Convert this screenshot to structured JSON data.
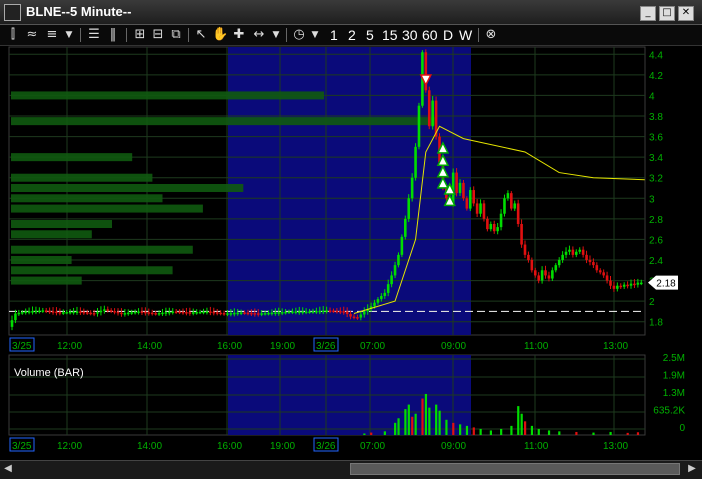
{
  "window": {
    "title": "BLNE--5 Minute--"
  },
  "window_buttons": {
    "minimize": "_",
    "restore": "□",
    "close": "✕"
  },
  "toolbar": {
    "intervals": [
      "1",
      "2",
      "5",
      "15",
      "30",
      "60",
      "D",
      "W"
    ]
  },
  "chart": {
    "price_axis_labels": [
      "4.4",
      "4.2",
      "4",
      "3.8",
      "3.6",
      "3.4",
      "3.2",
      "3",
      "2.8",
      "2.6",
      "2.4",
      "2.2",
      "2",
      "1.8"
    ],
    "current_price": "2.18",
    "time_labels": [
      "3/25",
      "12:00",
      "14:00",
      "16:00",
      "19:00",
      "3/26",
      "07:00",
      "09:00",
      "11:00",
      "13:00"
    ],
    "volume_label": "Volume (BAR)",
    "volume_axis_labels": [
      "2.5M",
      "1.9M",
      "1.3M",
      "635.2K",
      "0"
    ],
    "colors": {
      "up": "#00dd00",
      "down": "#e01010",
      "vwap": "#e6e600",
      "session": "#0a0a7a",
      "grid": "#1e3a1e",
      "axis_text": "#00b000"
    }
  },
  "chart_data": {
    "type": "candlestick",
    "title": "BLNE--5 Minute--",
    "ylim": [
      1.7,
      4.5
    ],
    "price_path": [
      [
        0,
        1.75
      ],
      [
        2,
        1.88
      ],
      [
        5,
        1.9
      ],
      [
        10,
        1.91
      ],
      [
        15,
        1.89
      ],
      [
        20,
        1.9
      ],
      [
        25,
        1.88
      ],
      [
        28,
        1.92
      ],
      [
        33,
        1.88
      ],
      [
        38,
        1.9
      ],
      [
        43,
        1.88
      ],
      [
        48,
        1.9
      ],
      [
        53,
        1.89
      ],
      [
        58,
        1.9
      ],
      [
        63,
        1.88
      ],
      [
        68,
        1.89
      ],
      [
        73,
        1.88
      ],
      [
        78,
        1.89
      ],
      [
        83,
        1.9
      ],
      [
        88,
        1.9
      ],
      [
        93,
        1.91
      ],
      [
        98,
        1.9
      ],
      [
        100,
        1.85
      ],
      [
        102,
        1.84
      ],
      [
        104,
        1.9
      ],
      [
        106,
        1.95
      ],
      [
        108,
        2.02
      ],
      [
        110,
        2.08
      ],
      [
        112,
        2.25
      ],
      [
        114,
        2.45
      ],
      [
        116,
        2.8
      ],
      [
        118,
        3.2
      ],
      [
        119,
        3.5
      ],
      [
        120,
        3.9
      ],
      [
        121,
        4.42
      ],
      [
        122,
        4.05
      ],
      [
        123,
        3.7
      ],
      [
        124,
        3.95
      ],
      [
        125,
        3.6
      ],
      [
        126,
        3.35
      ],
      [
        127,
        3.1
      ],
      [
        128,
        3.0
      ],
      [
        129,
        2.95
      ],
      [
        130,
        3.25
      ],
      [
        131,
        3.05
      ],
      [
        132,
        3.15
      ],
      [
        133,
        3.0
      ],
      [
        134,
        2.9
      ],
      [
        135,
        3.08
      ],
      [
        136,
        2.95
      ],
      [
        137,
        2.85
      ],
      [
        138,
        2.95
      ],
      [
        139,
        2.8
      ],
      [
        140,
        2.7
      ],
      [
        141,
        2.75
      ],
      [
        142,
        2.68
      ],
      [
        143,
        2.72
      ],
      [
        144,
        2.85
      ],
      [
        145,
        3.0
      ],
      [
        146,
        3.05
      ],
      [
        147,
        2.9
      ],
      [
        148,
        2.95
      ],
      [
        149,
        2.75
      ],
      [
        150,
        2.55
      ],
      [
        151,
        2.45
      ],
      [
        152,
        2.4
      ],
      [
        153,
        2.3
      ],
      [
        154,
        2.25
      ],
      [
        155,
        2.2
      ],
      [
        156,
        2.3
      ],
      [
        157,
        2.25
      ],
      [
        158,
        2.22
      ],
      [
        159,
        2.3
      ],
      [
        160,
        2.35
      ],
      [
        161,
        2.4
      ],
      [
        162,
        2.45
      ],
      [
        163,
        2.48
      ],
      [
        164,
        2.5
      ],
      [
        165,
        2.45
      ],
      [
        166,
        2.48
      ],
      [
        167,
        2.5
      ],
      [
        168,
        2.45
      ],
      [
        169,
        2.4
      ],
      [
        170,
        2.38
      ],
      [
        171,
        2.35
      ],
      [
        172,
        2.3
      ],
      [
        173,
        2.28
      ],
      [
        174,
        2.25
      ],
      [
        175,
        2.2
      ],
      [
        176,
        2.15
      ],
      [
        177,
        2.12
      ],
      [
        178,
        2.15
      ],
      [
        179,
        2.14
      ],
      [
        180,
        2.16
      ],
      [
        181,
        2.15
      ],
      [
        182,
        2.17
      ],
      [
        183,
        2.16
      ],
      [
        184,
        2.18
      ],
      [
        185,
        2.18
      ]
    ],
    "vwap": [
      [
        100,
        1.88
      ],
      [
        112,
        2.0
      ],
      [
        118,
        2.6
      ],
      [
        121,
        3.45
      ],
      [
        125,
        3.7
      ],
      [
        132,
        3.58
      ],
      [
        150,
        3.45
      ],
      [
        160,
        3.25
      ],
      [
        170,
        3.2
      ],
      [
        185,
        3.18
      ]
    ],
    "volume_profile": [
      [
        4.0,
        0.31
      ],
      [
        3.75,
        0.42
      ],
      [
        3.4,
        0.12
      ],
      [
        3.2,
        0.14
      ],
      [
        3.1,
        0.23
      ],
      [
        3.0,
        0.15
      ],
      [
        2.9,
        0.19
      ],
      [
        2.75,
        0.1
      ],
      [
        2.65,
        0.08
      ],
      [
        2.5,
        0.18
      ],
      [
        2.4,
        0.06
      ],
      [
        2.3,
        0.16
      ],
      [
        2.2,
        0.07
      ]
    ],
    "volume": [
      [
        103,
        0.05
      ],
      [
        105,
        0.08
      ],
      [
        109,
        0.12
      ],
      [
        112,
        0.4
      ],
      [
        113,
        0.55
      ],
      [
        115,
        0.85
      ],
      [
        116,
        1.0
      ],
      [
        117,
        0.6
      ],
      [
        118,
        0.7
      ],
      [
        120,
        1.2
      ],
      [
        121,
        1.35
      ],
      [
        122,
        0.9
      ],
      [
        124,
        1.0
      ],
      [
        125,
        0.8
      ],
      [
        127,
        0.5
      ],
      [
        129,
        0.4
      ],
      [
        131,
        0.35
      ],
      [
        133,
        0.3
      ],
      [
        135,
        0.25
      ],
      [
        137,
        0.2
      ],
      [
        140,
        0.15
      ],
      [
        143,
        0.2
      ],
      [
        146,
        0.3
      ],
      [
        148,
        0.95
      ],
      [
        149,
        0.7
      ],
      [
        150,
        0.45
      ],
      [
        152,
        0.3
      ],
      [
        154,
        0.2
      ],
      [
        157,
        0.15
      ],
      [
        160,
        0.12
      ],
      [
        165,
        0.1
      ],
      [
        170,
        0.08
      ],
      [
        175,
        0.1
      ],
      [
        180,
        0.07
      ],
      [
        183,
        0.09
      ]
    ],
    "volume_ylim": [
      0,
      2.5
    ],
    "dashed_line_price": 1.9,
    "signals": {
      "sell": [
        [
          121,
          4.15
        ]
      ],
      "buy": [
        [
          126,
          3.48
        ],
        [
          126,
          3.36
        ],
        [
          126,
          3.25
        ],
        [
          126,
          3.14
        ],
        [
          128,
          3.08
        ],
        [
          128,
          2.97
        ]
      ]
    }
  }
}
